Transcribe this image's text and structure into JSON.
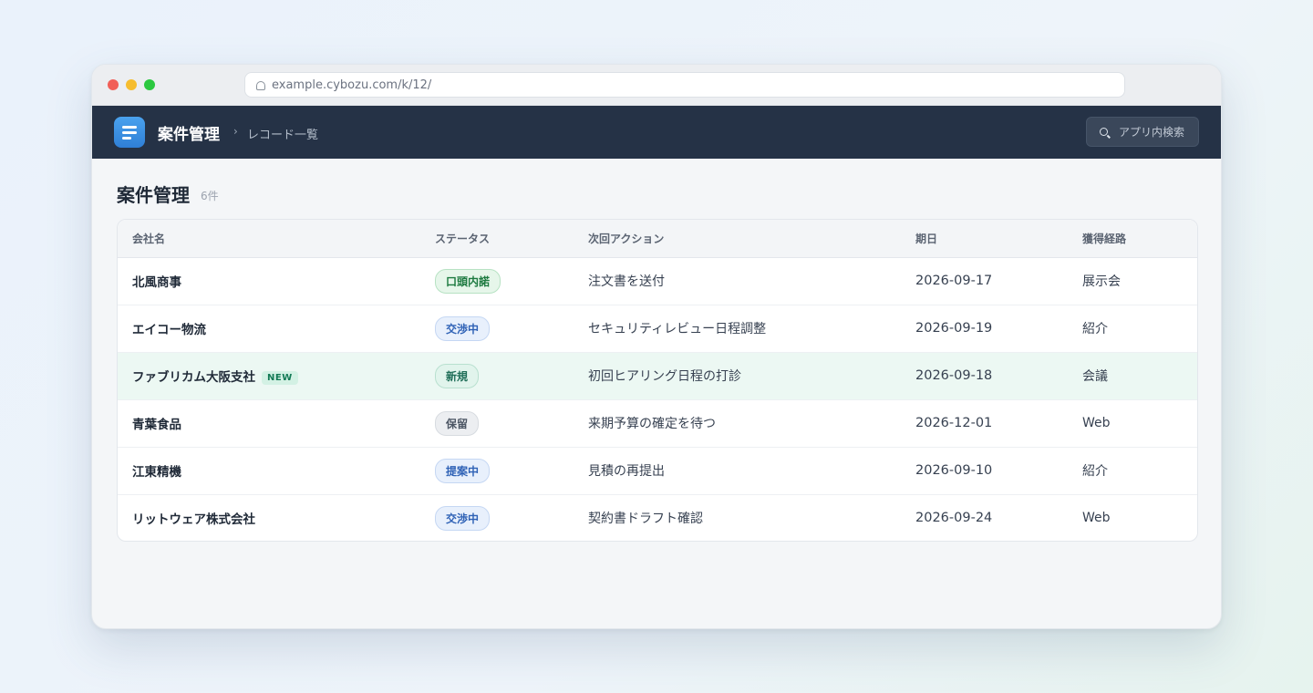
{
  "browser": {
    "url": "example.cybozu.com/k/12/"
  },
  "appbar": {
    "app_name": "案件管理",
    "breadcrumb_separator": "›",
    "breadcrumb": "レコード一覧",
    "search_label": "アプリ内検索"
  },
  "page": {
    "title": "案件管理",
    "count": "6件"
  },
  "table": {
    "columns": [
      "会社名",
      "ステータス",
      "次回アクション",
      "期日",
      "獲得経路"
    ],
    "rows": [
      {
        "company": "北風商事",
        "badge": "",
        "status": "口頭内諾",
        "status_color": "#1d7a40",
        "action": "注文書を送付",
        "due": "2026-09-17",
        "channel": "展示会"
      },
      {
        "company": "エイコー物流",
        "badge": "",
        "status": "交渉中",
        "status_color": "#2f62b6",
        "action": "セキュリティレビュー日程調整",
        "due": "2026-09-19",
        "channel": "紹介"
      },
      {
        "company": "ファブリカム大阪支社",
        "badge": "NEW",
        "status": "新規",
        "status_color": "#1f6e58",
        "action": "初回ヒアリング日程の打診",
        "due": "2026-09-18",
        "channel": "会議"
      },
      {
        "company": "青葉食品",
        "badge": "",
        "status": "保留",
        "status_color": "#4b5563",
        "action": "来期予算の確定を待つ",
        "due": "2026-12-01",
        "channel": "Web"
      },
      {
        "company": "江東精機",
        "badge": "",
        "status": "提案中",
        "status_color": "#2f62b6",
        "action": "見積の再提出",
        "due": "2026-09-10",
        "channel": "紹介"
      },
      {
        "company": "リットウェア株式会社",
        "badge": "",
        "status": "交渉中",
        "status_color": "#2f62b6",
        "action": "契約書ドラフト確認",
        "due": "2026-09-24",
        "channel": "Web"
      }
    ]
  }
}
